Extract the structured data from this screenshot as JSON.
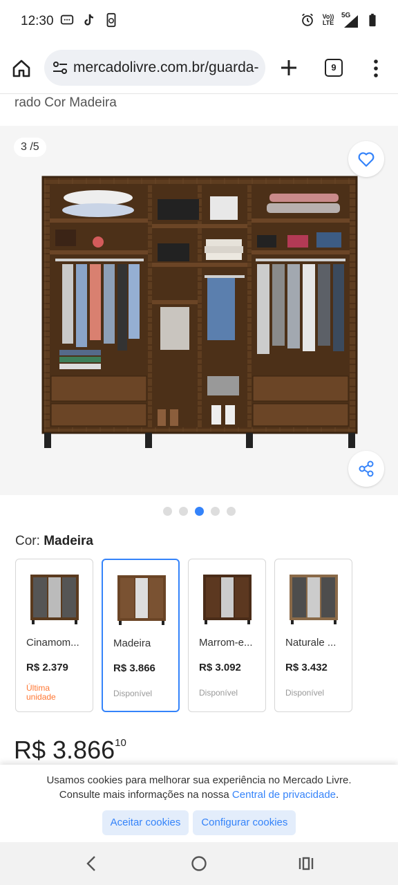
{
  "status_bar": {
    "time": "12:30",
    "volte_label": "Vo)) LTE",
    "network_label": "5G"
  },
  "browser": {
    "url": "mercadolivre.com.br/guarda-",
    "tab_count": "9"
  },
  "product": {
    "title_snippet": "rado Cor Madeira",
    "image_counter": "3 /5",
    "color_label": "Cor:",
    "color_value": "Madeira",
    "price_main": "R$ 3.866",
    "price_cents": "10"
  },
  "gallery": {
    "dot_count": 5,
    "active_index": 2
  },
  "variants": [
    {
      "name": "Cinamom...",
      "price": "R$ 2.379",
      "status": "Última unidade",
      "status_color": "#ff7733",
      "selected": false
    },
    {
      "name": "Madeira",
      "price": "R$ 3.866",
      "status": "Disponível",
      "status_color": "#999999",
      "selected": true
    },
    {
      "name": "Marrom-e...",
      "price": "R$ 3.092",
      "status": "Disponível",
      "status_color": "#999999",
      "selected": false
    },
    {
      "name": "Naturale ...",
      "price": "R$ 3.432",
      "status": "Disponível",
      "status_color": "#999999",
      "selected": false
    }
  ],
  "cookie_banner": {
    "line1": "Usamos cookies para melhorar sua experiência no Mercado Livre.",
    "line2_prefix": "Consulte mais informações na nossa ",
    "line2_link": "Central de privacidade",
    "line2_suffix": ".",
    "accept_label": "Aceitar cookies",
    "configure_label": "Configurar cookies"
  },
  "colors": {
    "accent": "#3483fa",
    "warning": "#ff7733",
    "wood": "#5a3a1e"
  }
}
